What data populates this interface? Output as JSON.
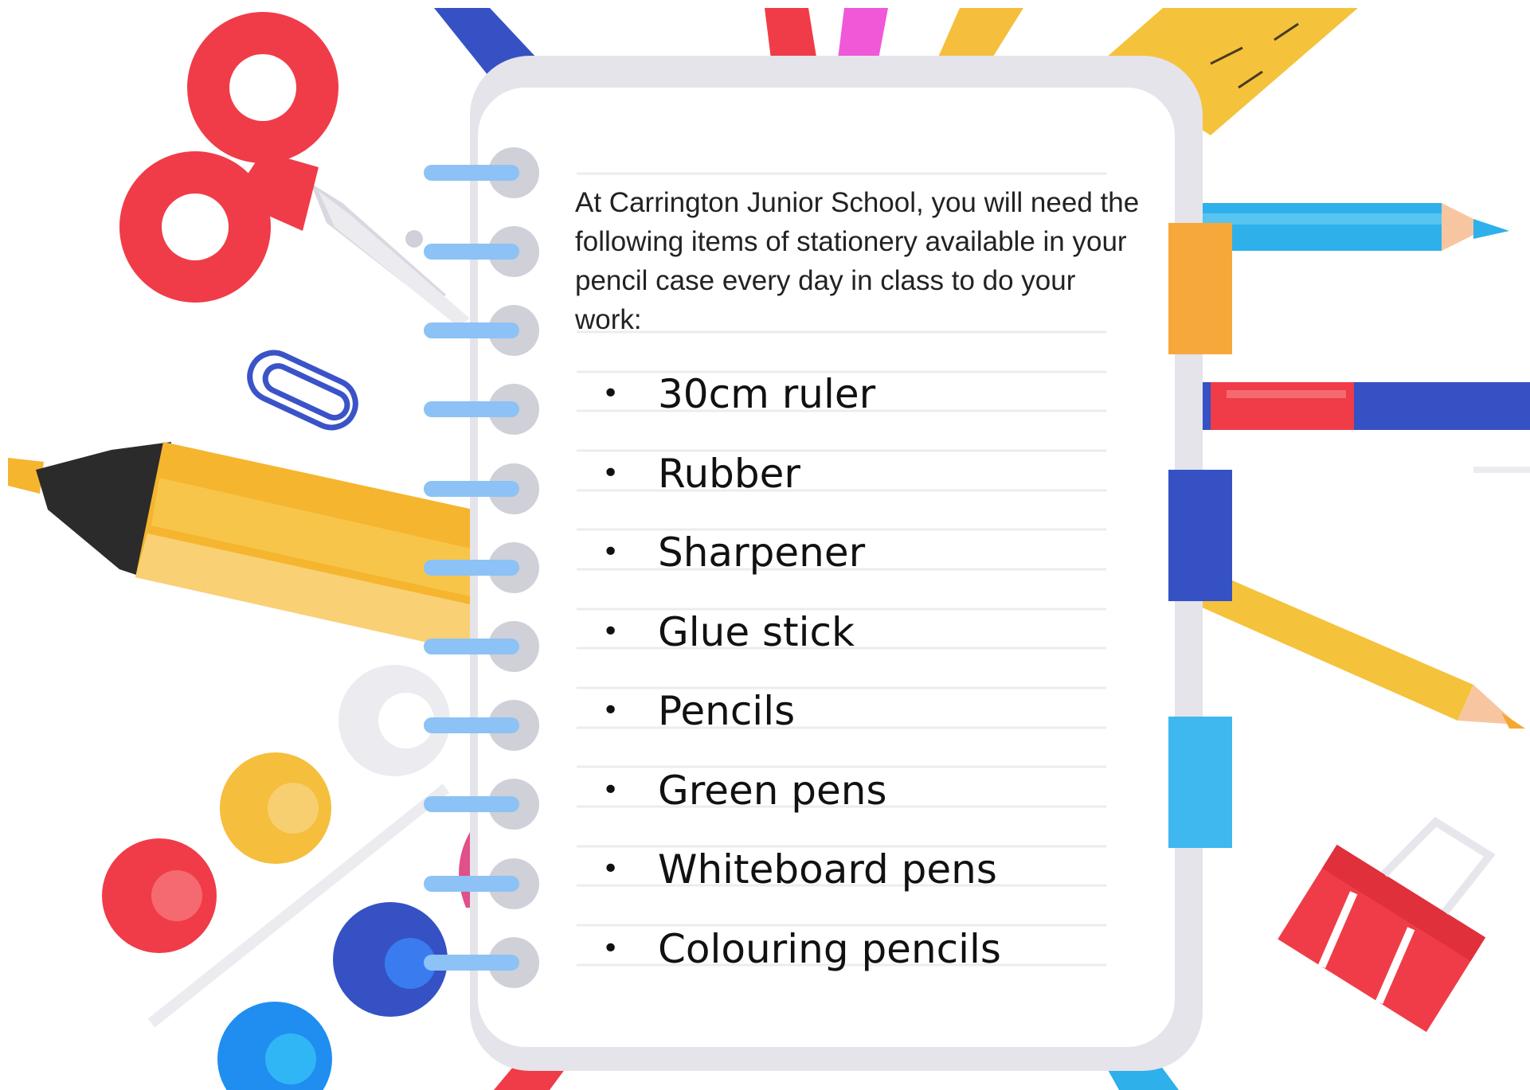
{
  "notebook": {
    "intro_text": "At Carrington Junior School, you will need the following items of stationery available in your pencil case every day in class to do your work:",
    "items": [
      "30cm ruler",
      "Rubber",
      "Sharpener",
      "Glue stick",
      "Pencils",
      "Green pens",
      "Whiteboard pens",
      "Colouring pencils"
    ],
    "bullet": "•"
  },
  "decorations": [
    "scissors-icon",
    "paper-clip-icon",
    "highlighter-icon",
    "push-pin-icon",
    "pencil-icon",
    "ruler-icon",
    "binder-clip-icon"
  ],
  "colors": {
    "red": "#f03c48",
    "yellow": "#f5be3c",
    "orange": "#f7a83a",
    "blue": "#3551c4",
    "light-blue": "#2eb0ea",
    "pink": "#f058d8",
    "gray": "#d0d0d8"
  }
}
